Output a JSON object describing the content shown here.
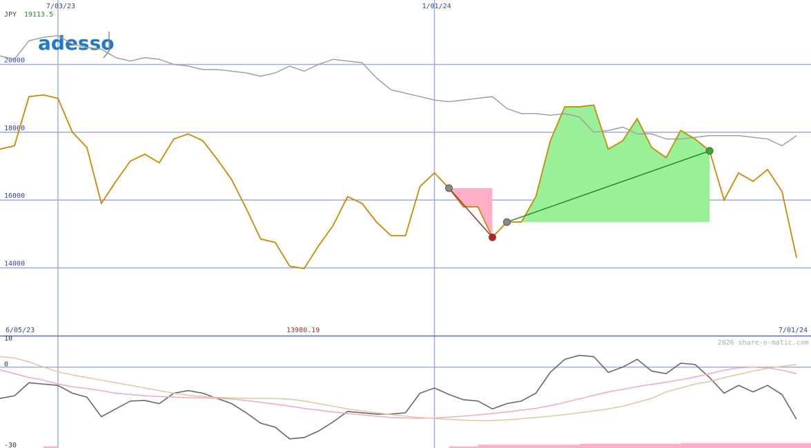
{
  "header": {
    "currency": "JPY",
    "last_value": "19113.5"
  },
  "logo": {
    "text": "adesso"
  },
  "period": {
    "start_label": "6/05/23",
    "end_label": "7/01/24",
    "low_label": "13980.19"
  },
  "footer": {
    "copyright": "2026 share-o-matic.com"
  },
  "colors": {
    "grid": "#99aaee",
    "price": "#cc8800",
    "benchmark": "#a0a0a0",
    "gain_fill": "#99f099",
    "gain_line": "#228822",
    "loss_fill": "#ffb0c8",
    "loss_line": "#993333",
    "label_blue": "#334499",
    "label_green": "#228822",
    "label_red": "#993333"
  },
  "chart_data": [
    {
      "type": "line",
      "name": "price-panel",
      "y_ticks": [
        14000,
        16000,
        18000,
        20000
      ],
      "ylim": [
        12000,
        21900
      ],
      "x_ticks": [
        {
          "date": "2023-07-03",
          "label": "7/03/23"
        },
        {
          "date": "2024-01-01",
          "label": "1/01/24"
        }
      ],
      "x_range": [
        "2023-06-05",
        "2024-07-01"
      ],
      "series": [
        {
          "role": "price",
          "points": [
            [
              "2023-06-05",
              17500
            ],
            [
              "2023-06-12",
              17600
            ],
            [
              "2023-06-19",
              19050
            ],
            [
              "2023-06-26",
              19100
            ],
            [
              "2023-07-03",
              19000
            ],
            [
              "2023-07-10",
              18000
            ],
            [
              "2023-07-17",
              17550
            ],
            [
              "2023-07-24",
              15900
            ],
            [
              "2023-07-31",
              16550
            ],
            [
              "2023-08-07",
              17150
            ],
            [
              "2023-08-14",
              17350
            ],
            [
              "2023-08-21",
              17100
            ],
            [
              "2023-08-28",
              17800
            ],
            [
              "2023-09-04",
              17950
            ],
            [
              "2023-09-11",
              17750
            ],
            [
              "2023-09-18",
              17200
            ],
            [
              "2023-09-25",
              16600
            ],
            [
              "2023-10-02",
              15750
            ],
            [
              "2023-10-09",
              14850
            ],
            [
              "2023-10-16",
              14750
            ],
            [
              "2023-10-23",
              14050
            ],
            [
              "2023-10-30",
              13980
            ],
            [
              "2023-11-06",
              14650
            ],
            [
              "2023-11-13",
              15250
            ],
            [
              "2023-11-20",
              16100
            ],
            [
              "2023-11-27",
              15900
            ],
            [
              "2023-12-04",
              15350
            ],
            [
              "2023-12-11",
              14950
            ],
            [
              "2023-12-18",
              14950
            ],
            [
              "2023-12-25",
              16400
            ],
            [
              "2024-01-01",
              16800
            ],
            [
              "2024-01-08",
              16350
            ],
            [
              "2024-01-15",
              15800
            ],
            [
              "2024-01-22",
              15800
            ],
            [
              "2024-01-29",
              14900
            ],
            [
              "2024-02-05",
              15350
            ],
            [
              "2024-02-12",
              15350
            ],
            [
              "2024-02-19",
              16100
            ],
            [
              "2024-02-26",
              17750
            ],
            [
              "2024-03-04",
              18750
            ],
            [
              "2024-03-11",
              18750
            ],
            [
              "2024-03-18",
              18800
            ],
            [
              "2024-03-25",
              17500
            ],
            [
              "2024-04-01",
              17750
            ],
            [
              "2024-04-08",
              18400
            ],
            [
              "2024-04-15",
              17550
            ],
            [
              "2024-04-22",
              17250
            ],
            [
              "2024-04-29",
              18050
            ],
            [
              "2024-05-06",
              17800
            ],
            [
              "2024-05-13",
              17450
            ],
            [
              "2024-05-20",
              16000
            ],
            [
              "2024-05-27",
              16800
            ],
            [
              "2024-06-03",
              16550
            ],
            [
              "2024-06-10",
              16900
            ],
            [
              "2024-06-17",
              16250
            ],
            [
              "2024-06-24",
              14300
            ]
          ]
        },
        {
          "role": "benchmark",
          "points": [
            [
              "2023-06-05",
              20250
            ],
            [
              "2023-06-12",
              20150
            ],
            [
              "2023-06-19",
              20700
            ],
            [
              "2023-06-26",
              20800
            ],
            [
              "2023-07-03",
              20850
            ],
            [
              "2023-07-10",
              20600
            ],
            [
              "2023-07-17",
              20500
            ],
            [
              "2023-07-24",
              20450
            ],
            [
              "2023-07-31",
              20200
            ],
            [
              "2023-08-07",
              20100
            ],
            [
              "2023-08-14",
              20200
            ],
            [
              "2023-08-21",
              20150
            ],
            [
              "2023-08-28",
              20000
            ],
            [
              "2023-09-04",
              19950
            ],
            [
              "2023-09-11",
              19850
            ],
            [
              "2023-09-18",
              19850
            ],
            [
              "2023-09-25",
              19800
            ],
            [
              "2023-10-02",
              19750
            ],
            [
              "2023-10-09",
              19650
            ],
            [
              "2023-10-16",
              19750
            ],
            [
              "2023-10-23",
              19950
            ],
            [
              "2023-10-30",
              19800
            ],
            [
              "2023-11-06",
              20000
            ],
            [
              "2023-11-13",
              20150
            ],
            [
              "2023-11-20",
              20100
            ],
            [
              "2023-11-27",
              20050
            ],
            [
              "2023-12-04",
              19600
            ],
            [
              "2023-12-11",
              19250
            ],
            [
              "2023-12-18",
              19150
            ],
            [
              "2023-12-25",
              19050
            ],
            [
              "2024-01-01",
              18950
            ],
            [
              "2024-01-08",
              18900
            ],
            [
              "2024-01-15",
              18950
            ],
            [
              "2024-01-22",
              19000
            ],
            [
              "2024-01-29",
              19050
            ],
            [
              "2024-02-05",
              18700
            ],
            [
              "2024-02-12",
              18550
            ],
            [
              "2024-02-19",
              18550
            ],
            [
              "2024-02-26",
              18500
            ],
            [
              "2024-03-04",
              18550
            ],
            [
              "2024-03-11",
              18450
            ],
            [
              "2024-03-18",
              18000
            ],
            [
              "2024-03-25",
              18050
            ],
            [
              "2024-04-01",
              18150
            ],
            [
              "2024-04-08",
              17950
            ],
            [
              "2024-04-15",
              17950
            ],
            [
              "2024-04-22",
              17800
            ],
            [
              "2024-04-29",
              17800
            ],
            [
              "2024-05-06",
              17850
            ],
            [
              "2024-05-13",
              17900
            ],
            [
              "2024-05-20",
              17900
            ],
            [
              "2024-05-27",
              17900
            ],
            [
              "2024-06-03",
              17850
            ],
            [
              "2024-06-10",
              17800
            ],
            [
              "2024-06-17",
              17600
            ],
            [
              "2024-06-24",
              17900
            ]
          ]
        }
      ],
      "annotations": [
        {
          "kind": "loss",
          "start": [
            "2024-01-08",
            16350
          ],
          "end": [
            "2024-01-29",
            14900
          ]
        },
        {
          "kind": "gain",
          "start": [
            "2024-02-05",
            15350
          ],
          "end": [
            "2024-05-13",
            17450
          ]
        }
      ]
    },
    {
      "type": "line",
      "name": "indicator-panel",
      "y_ticks": [
        10,
        0,
        -30
      ],
      "ylim": [
        -31,
        11
      ],
      "series": [
        {
          "role": "momentum",
          "color": "#666666",
          "values": [
            -12,
            -11,
            -6,
            -6.5,
            -7,
            -10,
            -11.5,
            -19,
            -16,
            -13,
            -12.8,
            -14,
            -10,
            -9,
            -10,
            -12,
            -14,
            -17.5,
            -21.5,
            -23,
            -27.5,
            -27,
            -24.5,
            -21,
            -17,
            -17.5,
            -18,
            -18,
            -17.5,
            -10,
            -8,
            -10.5,
            -12.5,
            -13,
            -16,
            -14,
            -13,
            -10,
            -2,
            3,
            4.5,
            4,
            -2,
            0,
            3,
            -1.5,
            -2.5,
            1.5,
            1,
            -4,
            -10,
            -7,
            -9.5,
            -7,
            -10.5,
            -20
          ]
        },
        {
          "role": "signal",
          "color": "#f0a8c0",
          "values": [
            -1,
            -2.5,
            -4,
            -5,
            -6.5,
            -7.5,
            -8.2,
            -9,
            -10,
            -10.5,
            -11,
            -11.3,
            -11.5,
            -11.7,
            -11.8,
            -11.9,
            -12.2,
            -12.8,
            -13.5,
            -14.2,
            -15,
            -15.8,
            -16.5,
            -17.2,
            -17.8,
            -18.3,
            -18.8,
            -19.3,
            -19.5,
            -19.6,
            -19.5,
            -19.2,
            -18.8,
            -18.3,
            -17.8,
            -17.2,
            -16.5,
            -15.8,
            -14.8,
            -13.5,
            -12.2,
            -10.8,
            -9.5,
            -8.5,
            -7.5,
            -6.6,
            -5.8,
            -4.8,
            -3.8,
            -2.5,
            -1.2,
            -0.3,
            0,
            -0.3,
            -1.2,
            -2.5
          ]
        },
        {
          "role": "slow",
          "color": "#e0c898",
          "values": [
            4,
            3.5,
            2,
            0,
            -1.8,
            -3,
            -4,
            -5,
            -6,
            -7,
            -8,
            -9,
            -10,
            -10.8,
            -11.3,
            -11.6,
            -11.8,
            -11.9,
            -12,
            -12,
            -12.3,
            -13,
            -14,
            -15,
            -16,
            -16.8,
            -17.5,
            -18.2,
            -18.8,
            -19.3,
            -19.7,
            -20,
            -20.3,
            -20.5,
            -20.5,
            -20.2,
            -19.8,
            -19.3,
            -18.8,
            -18.2,
            -17.5,
            -16.8,
            -16,
            -15,
            -13.5,
            -12,
            -9.5,
            -8,
            -6.5,
            -5.5,
            -4,
            -2.8,
            -1.5,
            -0.5,
            0.3,
            1
          ]
        }
      ],
      "volume_bars": [
        {
          "from": 3,
          "to": 4,
          "value": 1
        },
        {
          "from": 31,
          "to": 33,
          "value": 1
        },
        {
          "from": 33,
          "to": 40,
          "value": 2
        },
        {
          "from": 40,
          "to": 41,
          "value": 2.5
        },
        {
          "from": 41,
          "to": 47,
          "value": 2.5
        },
        {
          "from": 47,
          "to": 50,
          "value": 3
        },
        {
          "from": 50,
          "to": 54,
          "value": 3
        },
        {
          "from": 54,
          "to": 56,
          "value": 3
        }
      ]
    }
  ]
}
